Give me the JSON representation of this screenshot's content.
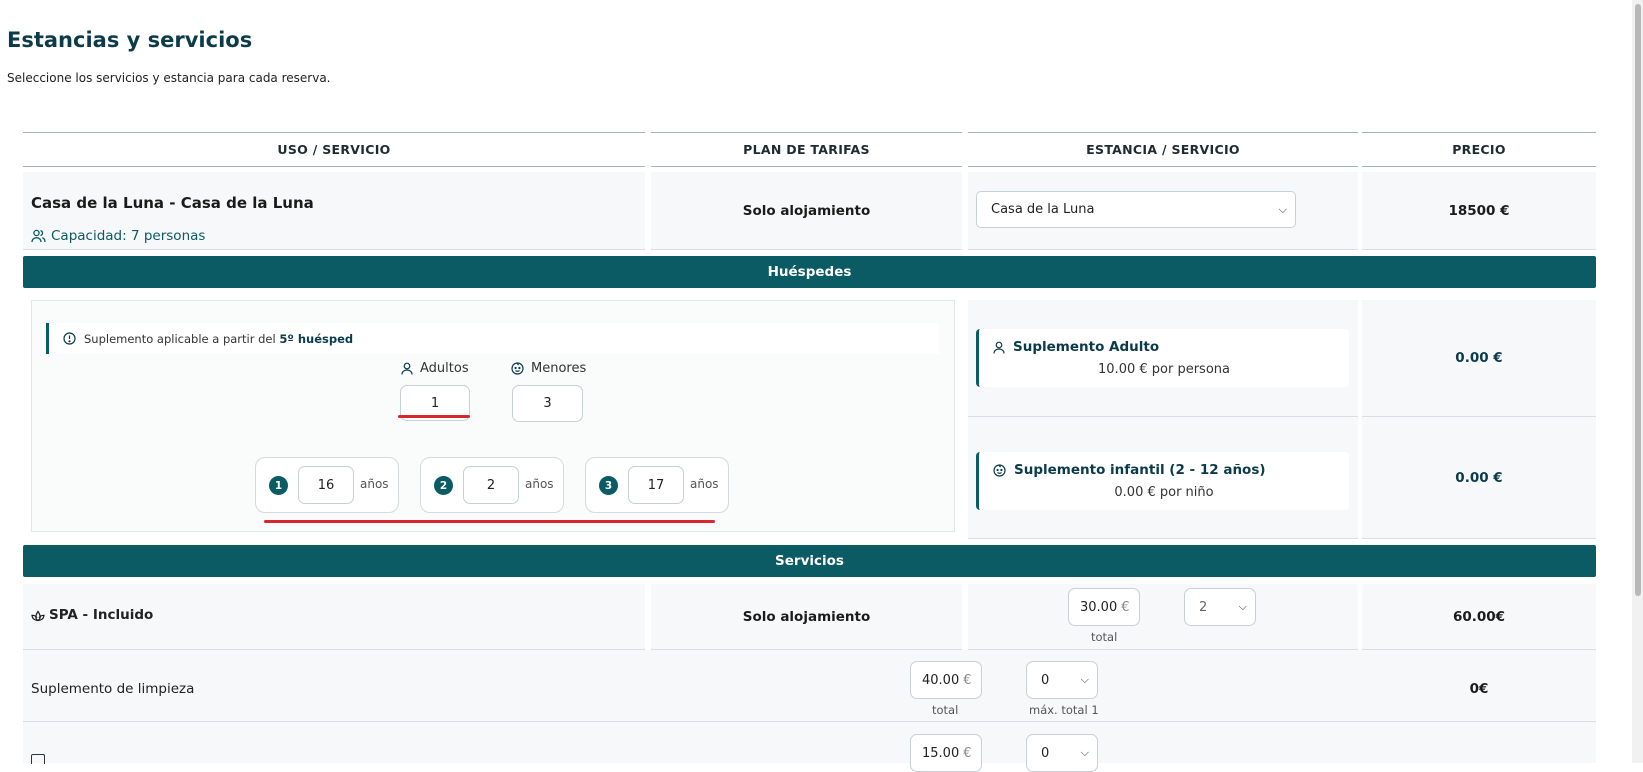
{
  "page": {
    "title": "Estancias y servicios",
    "subtitle": "Seleccione los servicios y estancia para cada reserva."
  },
  "table": {
    "headers": [
      "USO / SERVICIO",
      "PLAN DE TARIFAS",
      "ESTANCIA / SERVICIO",
      "PRECIO"
    ]
  },
  "room": {
    "name": "Casa de la Luna - Casa de la Luna",
    "capacity": "Capacidad: 7 personas",
    "rate_plan": "Solo alojamiento",
    "stay_selected": "Casa de la Luna",
    "price": "18500 €"
  },
  "guests": {
    "band_title": "Huéspedes",
    "note_prefix": "Suplemento aplicable a partir del",
    "note_bold": "5º huésped",
    "adults_label": "Adultos",
    "adults_value": "1",
    "minors_label": "Menores",
    "minors_value": "3",
    "children": [
      {
        "num": "1",
        "age": "16",
        "unit": "años"
      },
      {
        "num": "2",
        "age": "2",
        "unit": "años"
      },
      {
        "num": "3",
        "age": "17",
        "unit": "años"
      }
    ],
    "adult_supplement": {
      "title": "Suplemento Adulto",
      "detail": "10.00 € por persona",
      "price": "0.00 €"
    },
    "child_supplement": {
      "title": "Suplemento infantil (2 - 12 años)",
      "detail": "0.00 € por niño",
      "price": "0.00 €"
    }
  },
  "services": {
    "band_title": "Servicios",
    "spa": {
      "name": "SPA - Incluido",
      "rate_plan": "Solo alojamiento",
      "amount": "30.00",
      "currency": "€",
      "amount_caption": "total",
      "qty": "2",
      "price": "60.00€"
    },
    "cleaning": {
      "name": "Suplemento de limpieza",
      "amount": "40.00",
      "currency": "€",
      "amount_caption": "total",
      "qty": "0",
      "qty_caption": "máx. total 1",
      "price": "0€"
    },
    "third": {
      "amount": "15.00",
      "currency": "€",
      "qty": "0"
    }
  }
}
